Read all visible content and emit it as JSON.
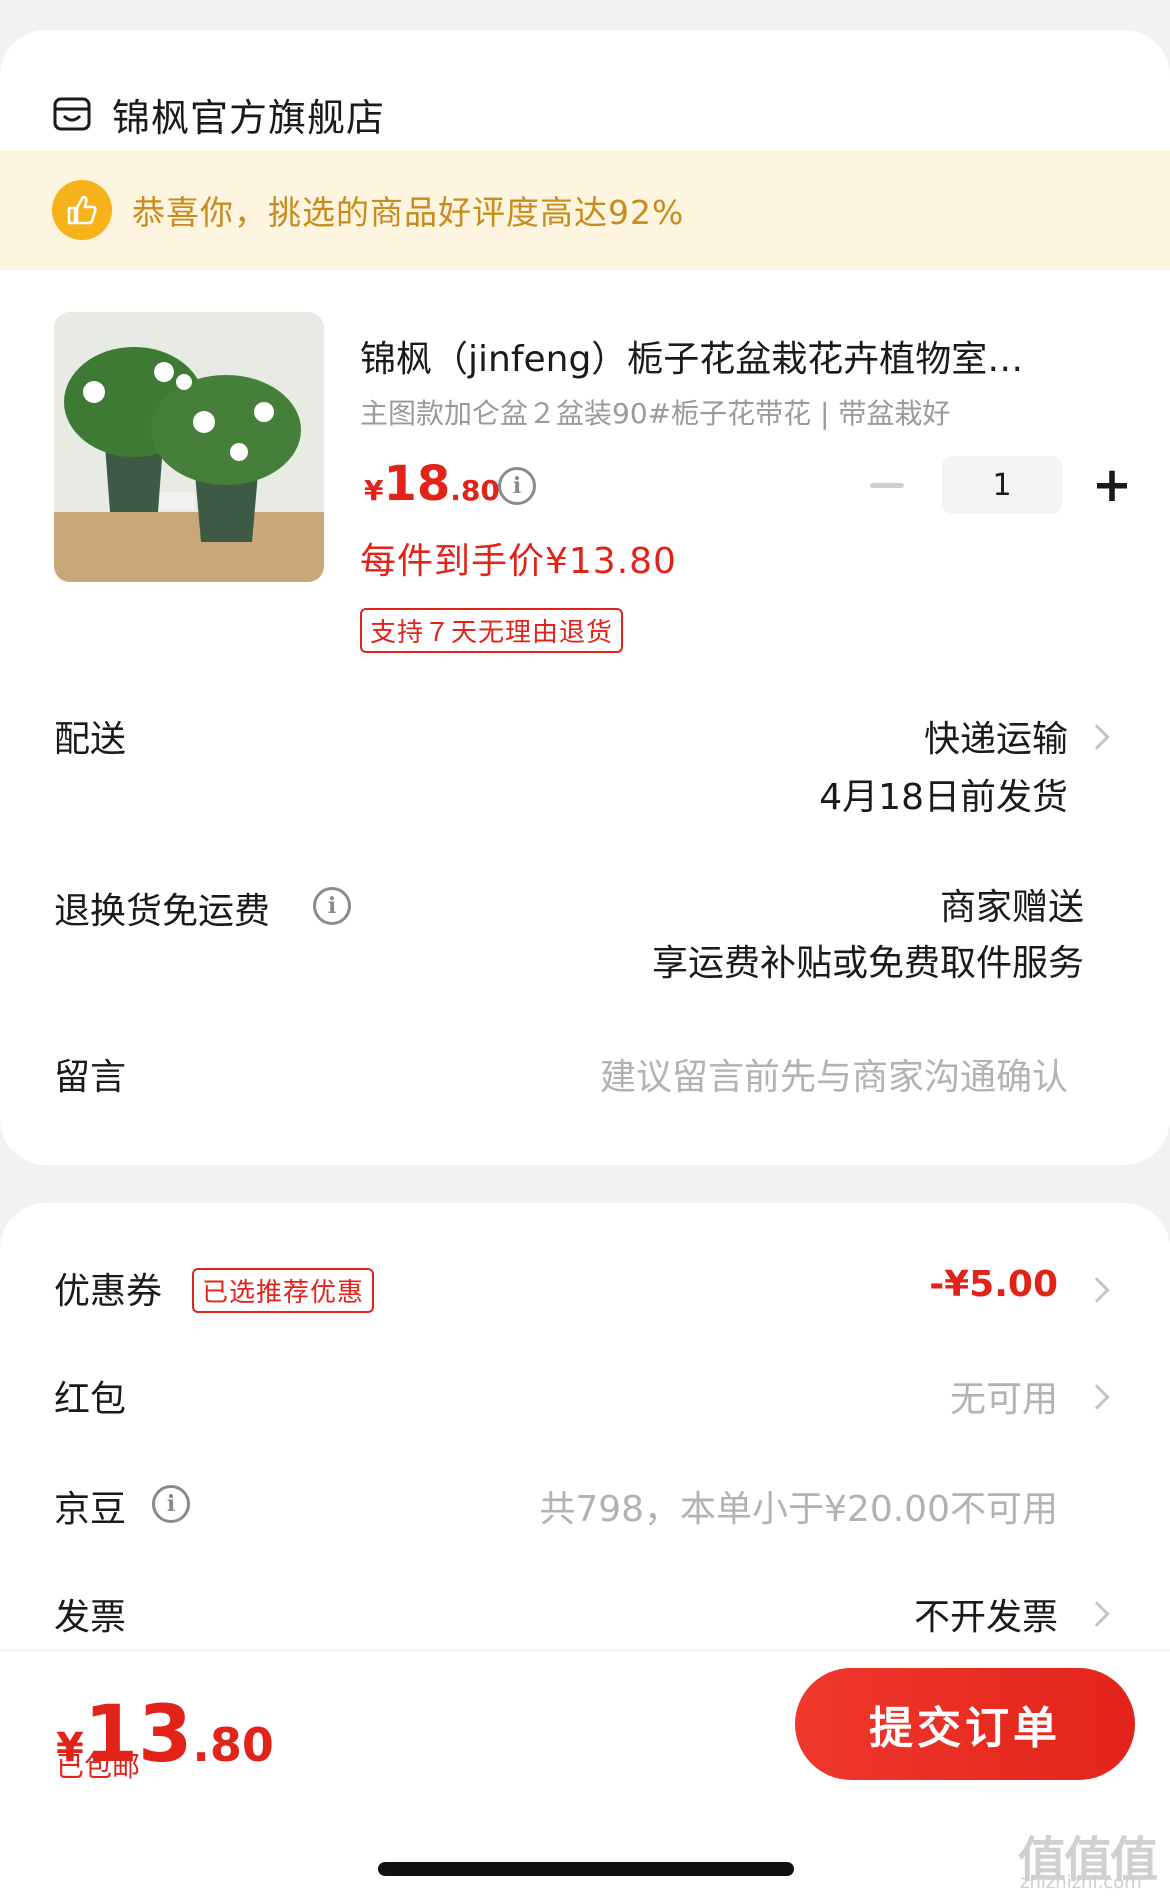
{
  "store": {
    "name": "锦枫官方旗舰店",
    "icon": "store-icon"
  },
  "banner": {
    "text": "恭喜你，挑选的商品好评度高达92%",
    "icon": "thumbs-up-icon"
  },
  "product": {
    "title": "锦枫（jinfeng）栀子花盆栽花卉植物室…",
    "spec": "主图款加仑盆２盆装90#栀子花带花 | 带盆栽好",
    "price_currency": "¥",
    "price_int": "18",
    "price_dec": ".80",
    "final_price": "每件到手价¥13.80",
    "return_tag": "支持７天无理由退货",
    "quantity": "1"
  },
  "delivery": {
    "label": "配送",
    "method": "快递运输",
    "date": "4月18日前发货"
  },
  "return_fee": {
    "label": "退换货免运费",
    "value1": "商家赠送",
    "value2": "享运费补贴或免费取件服务"
  },
  "message": {
    "label": "留言",
    "placeholder": "建议留言前先与商家沟通确认"
  },
  "coupon": {
    "label": "优惠券",
    "tag": "已选推荐优惠",
    "value": "-¥5.00"
  },
  "redpacket": {
    "label": "红包",
    "value": "无可用"
  },
  "jingdou": {
    "label": "京豆",
    "value": "共798，本单小于¥20.00不可用"
  },
  "invoice": {
    "label": "发票",
    "value": "不开发票"
  },
  "total": {
    "currency": "¥",
    "int": "13",
    "dec": ".80",
    "shipping": "已包邮"
  },
  "submit_label": "提交订单",
  "watermark": {
    "main": "值值值",
    "sub": "zhizhizhi.com"
  },
  "colors": {
    "accent": "#e2231a",
    "banner_bg": "#fdf5e0",
    "banner_text": "#c98b1b"
  }
}
